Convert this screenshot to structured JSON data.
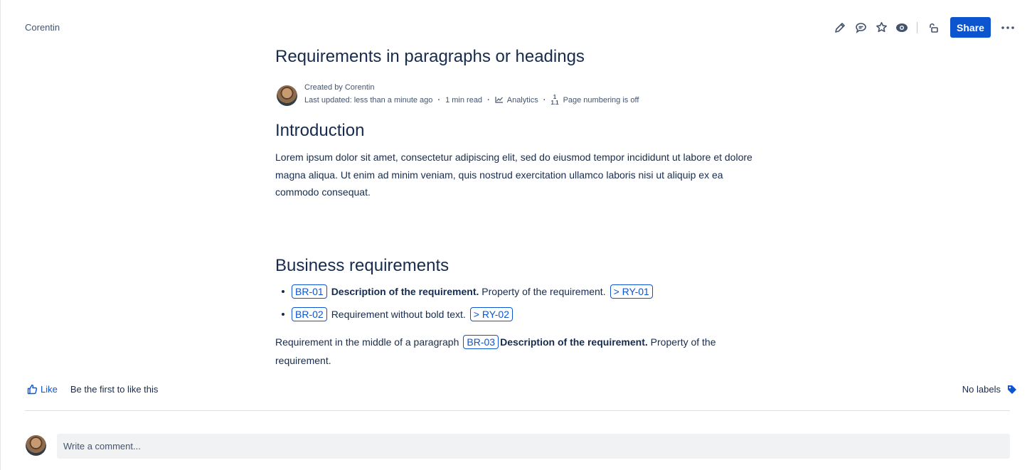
{
  "breadcrumb": {
    "space": "Corentin"
  },
  "toolbar": {
    "share_label": "Share",
    "icons": [
      "edit-icon",
      "comment-icon",
      "star-icon",
      "watch-icon",
      "restrictions-icon",
      "more-icon"
    ]
  },
  "page": {
    "title": "Requirements in paragraphs or headings",
    "byline": {
      "created_by": "Created by Corentin",
      "last_updated": "Last updated: less than a minute ago",
      "read_time": "1 min read",
      "analytics": "Analytics",
      "page_numbering": "Page numbering is off",
      "numbering_glyph_top": "1",
      "numbering_glyph_bottom": "1.1"
    }
  },
  "content": {
    "intro_heading": "Introduction",
    "intro_paragraph": "Lorem ipsum dolor sit amet, consectetur adipiscing elit, sed do eiusmod tempor incididunt ut labore et dolore magna aliqua. Ut enim ad minim veniam, quis nostrud exercitation ullamco laboris nisi ut aliquip ex ea commodo consequat.",
    "business_heading": "Business requirements",
    "requirements": [
      {
        "id": "BR-01",
        "bold": "Description of the requirement.",
        "text": " Property of the requirement.",
        "link": "> RY-01"
      },
      {
        "id": "BR-02",
        "bold": "",
        "text": "Requirement without bold text.",
        "link": "> RY-02"
      }
    ],
    "paragraph": {
      "prefix": "Requirement in the middle of a paragraph",
      "id": "BR-03",
      "bold": "Description of the requirement.",
      "suffix": " Property of the requirement."
    }
  },
  "footer": {
    "like_label": "Like",
    "like_prompt": "Be the first to like this",
    "labels_text": "No labels",
    "comment_placeholder": "Write a comment..."
  },
  "colors": {
    "accent": "#0c55cf",
    "text": "#172b4d",
    "subtle": "#44546f"
  }
}
